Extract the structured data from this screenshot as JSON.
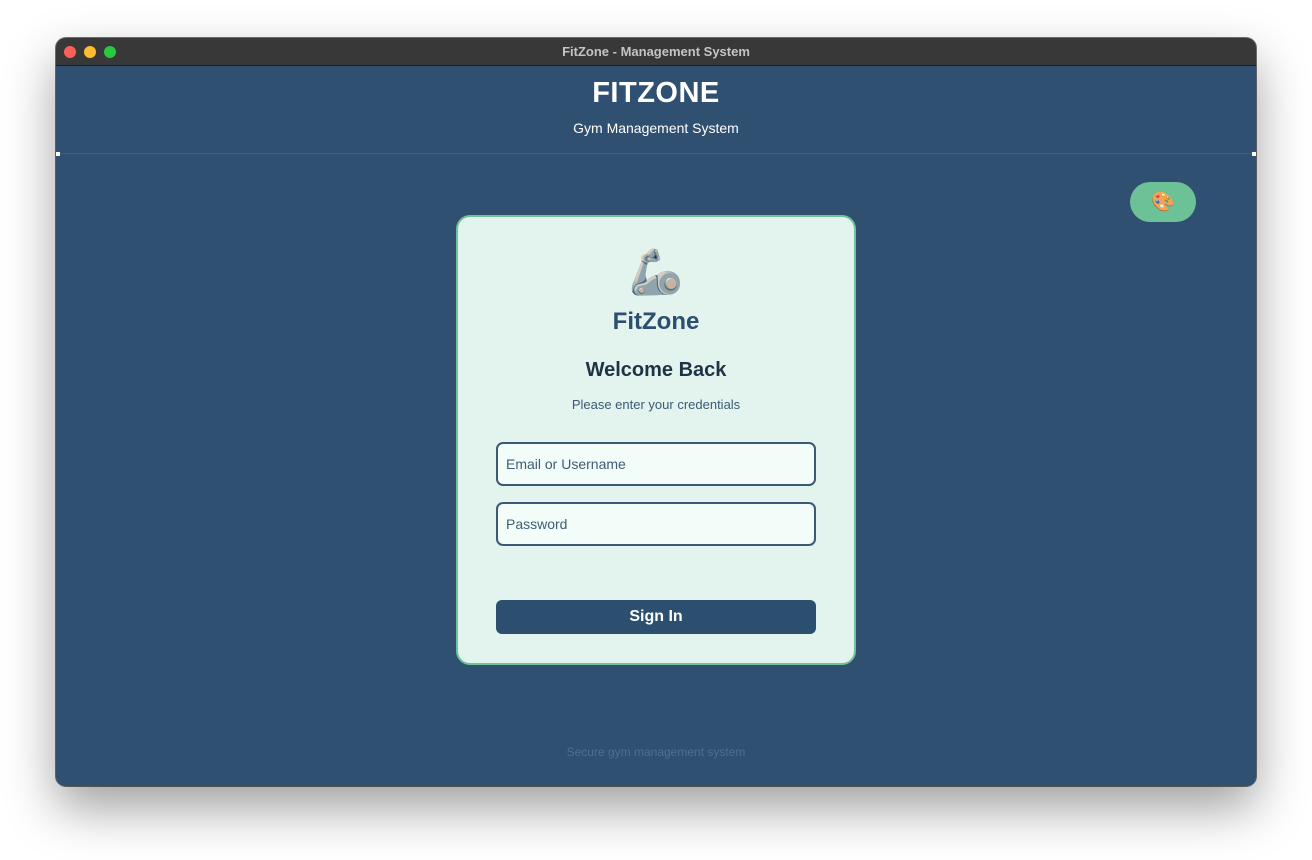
{
  "window": {
    "title": "FitZone - Management System"
  },
  "header": {
    "brand": "FITZONE",
    "tagline": "Gym Management System"
  },
  "theme_toggle": {
    "icon": "🎨",
    "icon_name": "palette-icon"
  },
  "login_card": {
    "logo_icon": "🦾",
    "logo_icon_name": "mechanical-arm-icon",
    "brand": "FitZone",
    "heading": "Welcome Back",
    "subtitle": "Please enter your credentials",
    "email_placeholder": "Email or Username",
    "password_placeholder": "Password",
    "submit_label": "Sign In"
  },
  "footer": {
    "note": "Secure gym management system"
  },
  "colors": {
    "background": "#2f5071",
    "card_background": "#e3f3ed",
    "card_border": "#6fc39a",
    "accent_green": "#6dc197",
    "primary_button": "#2c4f70"
  }
}
